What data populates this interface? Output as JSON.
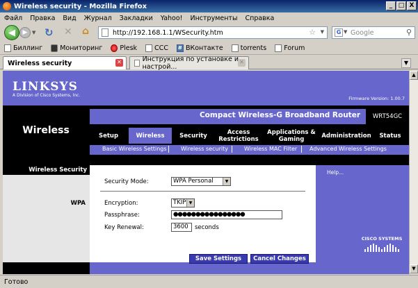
{
  "window": {
    "title": "Wireless security - Mozilla Firefox",
    "min": "_",
    "max": "□",
    "close": "X"
  },
  "menu": [
    "Файл",
    "Правка",
    "Вид",
    "Журнал",
    "Закладки",
    "Yahoo!",
    "Инструменты",
    "Справка"
  ],
  "nav": {
    "url": "http://192.168.1.1/WSecurity.htm",
    "search_placeholder": "Google"
  },
  "bookmarks": [
    "Биллинг",
    "Мониторинг",
    "Plesk",
    "CCC",
    "ВКонтакте",
    "torrents",
    "Forum"
  ],
  "tabs": [
    {
      "label": "Wireless security",
      "active": true
    },
    {
      "label": "Инструкция по установке и настрой...",
      "active": false
    }
  ],
  "page": {
    "brand": "LINKSYS",
    "brand_sub": "A Division of Cisco Systems, Inc.",
    "firmware": "Firmware Version: 1.00.7",
    "product_name": "Compact Wireless-G Broadband Router",
    "model": "WRT54GC",
    "section": "Wireless",
    "main_tabs": [
      "Setup",
      "Wireless",
      "Security",
      "Access Restrictions",
      "Applications & Gaming",
      "Administration",
      "Status"
    ],
    "sub_tabs": [
      "Basic Wireless Settings",
      "Wireless security",
      "Wireless MAC Filter",
      "Advanced Wireless Settings"
    ],
    "left_heading": "Wireless Security",
    "left_wpa": "WPA",
    "security_mode_label": "Security Mode:",
    "security_mode_value": "WPA Personal",
    "encryption_label": "Encryption:",
    "encryption_value": "TKIP",
    "passphrase_label": "Passphrase:",
    "passphrase_value": "●●●●●●●●●●●●●●●●",
    "key_renewal_label": "Key Renewal:",
    "key_renewal_value": "3600",
    "key_renewal_unit": "seconds",
    "help": "Help...",
    "save_label": "Save Settings",
    "cancel_label": "Cancel Changes",
    "cisco": "CISCO SYSTEMS"
  },
  "status": "Готово"
}
